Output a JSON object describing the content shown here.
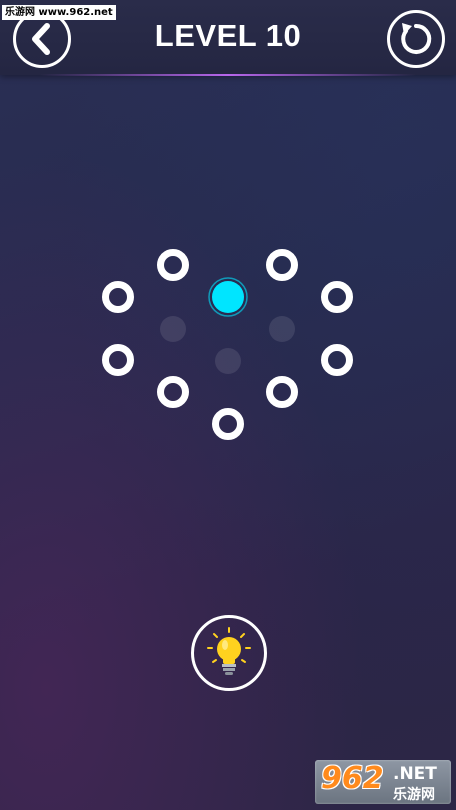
{
  "header": {
    "title": "LEVEL 10",
    "back_icon": "chevron-left-icon",
    "restart_icon": "restart-icon"
  },
  "watermark": {
    "top_text": "乐游网 www.962.net",
    "logo_number": "962",
    "logo_suffix": ".NET",
    "logo_cn": "乐游网"
  },
  "board": {
    "nodes": [
      {
        "id": "node-1",
        "state": "empty"
      },
      {
        "id": "node-2",
        "state": "empty"
      },
      {
        "id": "node-3",
        "state": "empty"
      },
      {
        "id": "node-4",
        "state": "empty"
      },
      {
        "id": "node-5",
        "state": "empty"
      },
      {
        "id": "node-6",
        "state": "empty"
      },
      {
        "id": "node-7",
        "state": "empty"
      },
      {
        "id": "node-8",
        "state": "empty"
      },
      {
        "id": "node-9",
        "state": "empty"
      },
      {
        "id": "start",
        "state": "active"
      },
      {
        "id": "faint-1",
        "state": "faint"
      },
      {
        "id": "faint-2",
        "state": "faint"
      },
      {
        "id": "faint-3",
        "state": "faint"
      }
    ]
  },
  "hint": {
    "icon": "lightbulb-icon"
  },
  "colors": {
    "active_node": "#00e5ff",
    "node_ring": "#ffffff",
    "bulb": "#ffd21f",
    "accent_line": "#c86eff"
  }
}
